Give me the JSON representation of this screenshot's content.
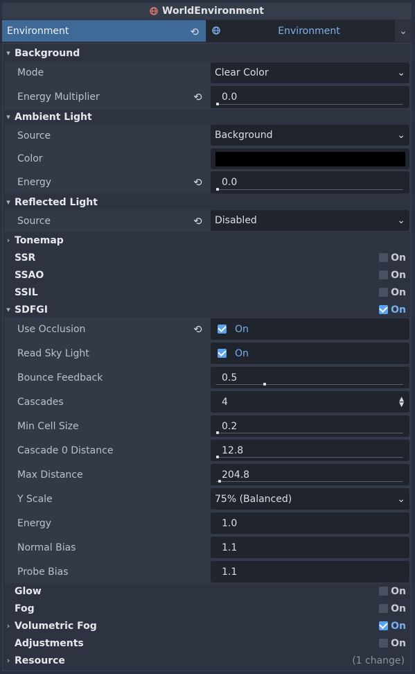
{
  "title": "WorldEnvironment",
  "resource": {
    "type_label": "Environment",
    "picker_label": "Environment"
  },
  "background": {
    "header": "Background",
    "mode_label": "Mode",
    "mode_value": "Clear Color",
    "energy_label": "Energy Multiplier",
    "energy_value": "0.0"
  },
  "ambient": {
    "header": "Ambient Light",
    "source_label": "Source",
    "source_value": "Background",
    "color_label": "Color",
    "color_value": "#000000",
    "energy_label": "Energy",
    "energy_value": "0.0"
  },
  "reflected": {
    "header": "Reflected Light",
    "source_label": "Source",
    "source_value": "Disabled"
  },
  "tonemap": {
    "header": "Tonemap"
  },
  "ssr": {
    "header": "SSR",
    "toggle": "On",
    "checked": false
  },
  "ssao": {
    "header": "SSAO",
    "toggle": "On",
    "checked": false
  },
  "ssil": {
    "header": "SSIL",
    "toggle": "On",
    "checked": false
  },
  "sdfgi": {
    "header": "SDFGI",
    "toggle": "On",
    "checked": true,
    "use_occlusion_label": "Use Occlusion",
    "use_occlusion_value": "On",
    "read_sky_label": "Read Sky Light",
    "read_sky_value": "On",
    "bounce_label": "Bounce Feedback",
    "bounce_value": "0.5",
    "bounce_fraction": 0.25,
    "cascades_label": "Cascades",
    "cascades_value": "4",
    "min_cell_label": "Min Cell Size",
    "min_cell_value": "0.2",
    "min_cell_fraction": 0.0,
    "cascade0_label": "Cascade 0 Distance",
    "cascade0_value": "12.8",
    "cascade0_fraction": 0.0,
    "max_dist_label": "Max Distance",
    "max_dist_value": "204.8",
    "max_dist_fraction": 0.01,
    "yscale_label": "Y Scale",
    "yscale_value": "75% (Balanced)",
    "energy_label": "Energy",
    "energy_value": "1.0",
    "normal_bias_label": "Normal Bias",
    "normal_bias_value": "1.1",
    "probe_bias_label": "Probe Bias",
    "probe_bias_value": "1.1"
  },
  "glow": {
    "header": "Glow",
    "toggle": "On",
    "checked": false
  },
  "fog": {
    "header": "Fog",
    "toggle": "On",
    "checked": false
  },
  "volumetric_fog": {
    "header": "Volumetric Fog",
    "toggle": "On",
    "checked": true
  },
  "adjustments": {
    "header": "Adjustments",
    "toggle": "On",
    "checked": false
  },
  "resource_section": {
    "header": "Resource",
    "changes": "(1 change)"
  },
  "icons": {
    "revert": "revert-icon",
    "globe": "globe-icon",
    "chevron": "chevron-down-icon",
    "expanded": "expanded-arrow-icon",
    "collapsed": "collapsed-arrow-icon"
  },
  "colors": {
    "accent": "#5aa3f0",
    "selected_header": "#3f6a98"
  }
}
